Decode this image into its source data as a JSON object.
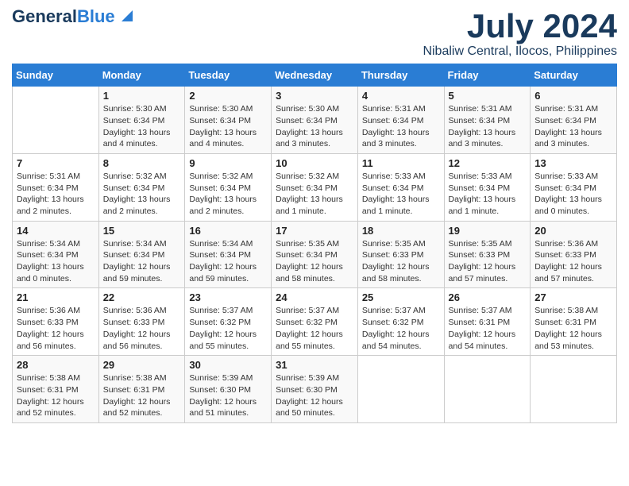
{
  "header": {
    "logo_line1": "General",
    "logo_line2": "Blue",
    "main_title": "July 2024",
    "subtitle": "Nibaliw Central, Ilocos, Philippines"
  },
  "calendar": {
    "days_of_week": [
      "Sunday",
      "Monday",
      "Tuesday",
      "Wednesday",
      "Thursday",
      "Friday",
      "Saturday"
    ],
    "weeks": [
      [
        {
          "day": "",
          "detail": ""
        },
        {
          "day": "1",
          "detail": "Sunrise: 5:30 AM\nSunset: 6:34 PM\nDaylight: 13 hours\nand 4 minutes."
        },
        {
          "day": "2",
          "detail": "Sunrise: 5:30 AM\nSunset: 6:34 PM\nDaylight: 13 hours\nand 4 minutes."
        },
        {
          "day": "3",
          "detail": "Sunrise: 5:30 AM\nSunset: 6:34 PM\nDaylight: 13 hours\nand 3 minutes."
        },
        {
          "day": "4",
          "detail": "Sunrise: 5:31 AM\nSunset: 6:34 PM\nDaylight: 13 hours\nand 3 minutes."
        },
        {
          "day": "5",
          "detail": "Sunrise: 5:31 AM\nSunset: 6:34 PM\nDaylight: 13 hours\nand 3 minutes."
        },
        {
          "day": "6",
          "detail": "Sunrise: 5:31 AM\nSunset: 6:34 PM\nDaylight: 13 hours\nand 3 minutes."
        }
      ],
      [
        {
          "day": "7",
          "detail": "Sunrise: 5:31 AM\nSunset: 6:34 PM\nDaylight: 13 hours\nand 2 minutes."
        },
        {
          "day": "8",
          "detail": "Sunrise: 5:32 AM\nSunset: 6:34 PM\nDaylight: 13 hours\nand 2 minutes."
        },
        {
          "day": "9",
          "detail": "Sunrise: 5:32 AM\nSunset: 6:34 PM\nDaylight: 13 hours\nand 2 minutes."
        },
        {
          "day": "10",
          "detail": "Sunrise: 5:32 AM\nSunset: 6:34 PM\nDaylight: 13 hours\nand 1 minute."
        },
        {
          "day": "11",
          "detail": "Sunrise: 5:33 AM\nSunset: 6:34 PM\nDaylight: 13 hours\nand 1 minute."
        },
        {
          "day": "12",
          "detail": "Sunrise: 5:33 AM\nSunset: 6:34 PM\nDaylight: 13 hours\nand 1 minute."
        },
        {
          "day": "13",
          "detail": "Sunrise: 5:33 AM\nSunset: 6:34 PM\nDaylight: 13 hours\nand 0 minutes."
        }
      ],
      [
        {
          "day": "14",
          "detail": "Sunrise: 5:34 AM\nSunset: 6:34 PM\nDaylight: 13 hours\nand 0 minutes."
        },
        {
          "day": "15",
          "detail": "Sunrise: 5:34 AM\nSunset: 6:34 PM\nDaylight: 12 hours\nand 59 minutes."
        },
        {
          "day": "16",
          "detail": "Sunrise: 5:34 AM\nSunset: 6:34 PM\nDaylight: 12 hours\nand 59 minutes."
        },
        {
          "day": "17",
          "detail": "Sunrise: 5:35 AM\nSunset: 6:34 PM\nDaylight: 12 hours\nand 58 minutes."
        },
        {
          "day": "18",
          "detail": "Sunrise: 5:35 AM\nSunset: 6:33 PM\nDaylight: 12 hours\nand 58 minutes."
        },
        {
          "day": "19",
          "detail": "Sunrise: 5:35 AM\nSunset: 6:33 PM\nDaylight: 12 hours\nand 57 minutes."
        },
        {
          "day": "20",
          "detail": "Sunrise: 5:36 AM\nSunset: 6:33 PM\nDaylight: 12 hours\nand 57 minutes."
        }
      ],
      [
        {
          "day": "21",
          "detail": "Sunrise: 5:36 AM\nSunset: 6:33 PM\nDaylight: 12 hours\nand 56 minutes."
        },
        {
          "day": "22",
          "detail": "Sunrise: 5:36 AM\nSunset: 6:33 PM\nDaylight: 12 hours\nand 56 minutes."
        },
        {
          "day": "23",
          "detail": "Sunrise: 5:37 AM\nSunset: 6:32 PM\nDaylight: 12 hours\nand 55 minutes."
        },
        {
          "day": "24",
          "detail": "Sunrise: 5:37 AM\nSunset: 6:32 PM\nDaylight: 12 hours\nand 55 minutes."
        },
        {
          "day": "25",
          "detail": "Sunrise: 5:37 AM\nSunset: 6:32 PM\nDaylight: 12 hours\nand 54 minutes."
        },
        {
          "day": "26",
          "detail": "Sunrise: 5:37 AM\nSunset: 6:31 PM\nDaylight: 12 hours\nand 54 minutes."
        },
        {
          "day": "27",
          "detail": "Sunrise: 5:38 AM\nSunset: 6:31 PM\nDaylight: 12 hours\nand 53 minutes."
        }
      ],
      [
        {
          "day": "28",
          "detail": "Sunrise: 5:38 AM\nSunset: 6:31 PM\nDaylight: 12 hours\nand 52 minutes."
        },
        {
          "day": "29",
          "detail": "Sunrise: 5:38 AM\nSunset: 6:31 PM\nDaylight: 12 hours\nand 52 minutes."
        },
        {
          "day": "30",
          "detail": "Sunrise: 5:39 AM\nSunset: 6:30 PM\nDaylight: 12 hours\nand 51 minutes."
        },
        {
          "day": "31",
          "detail": "Sunrise: 5:39 AM\nSunset: 6:30 PM\nDaylight: 12 hours\nand 50 minutes."
        },
        {
          "day": "",
          "detail": ""
        },
        {
          "day": "",
          "detail": ""
        },
        {
          "day": "",
          "detail": ""
        }
      ]
    ]
  }
}
